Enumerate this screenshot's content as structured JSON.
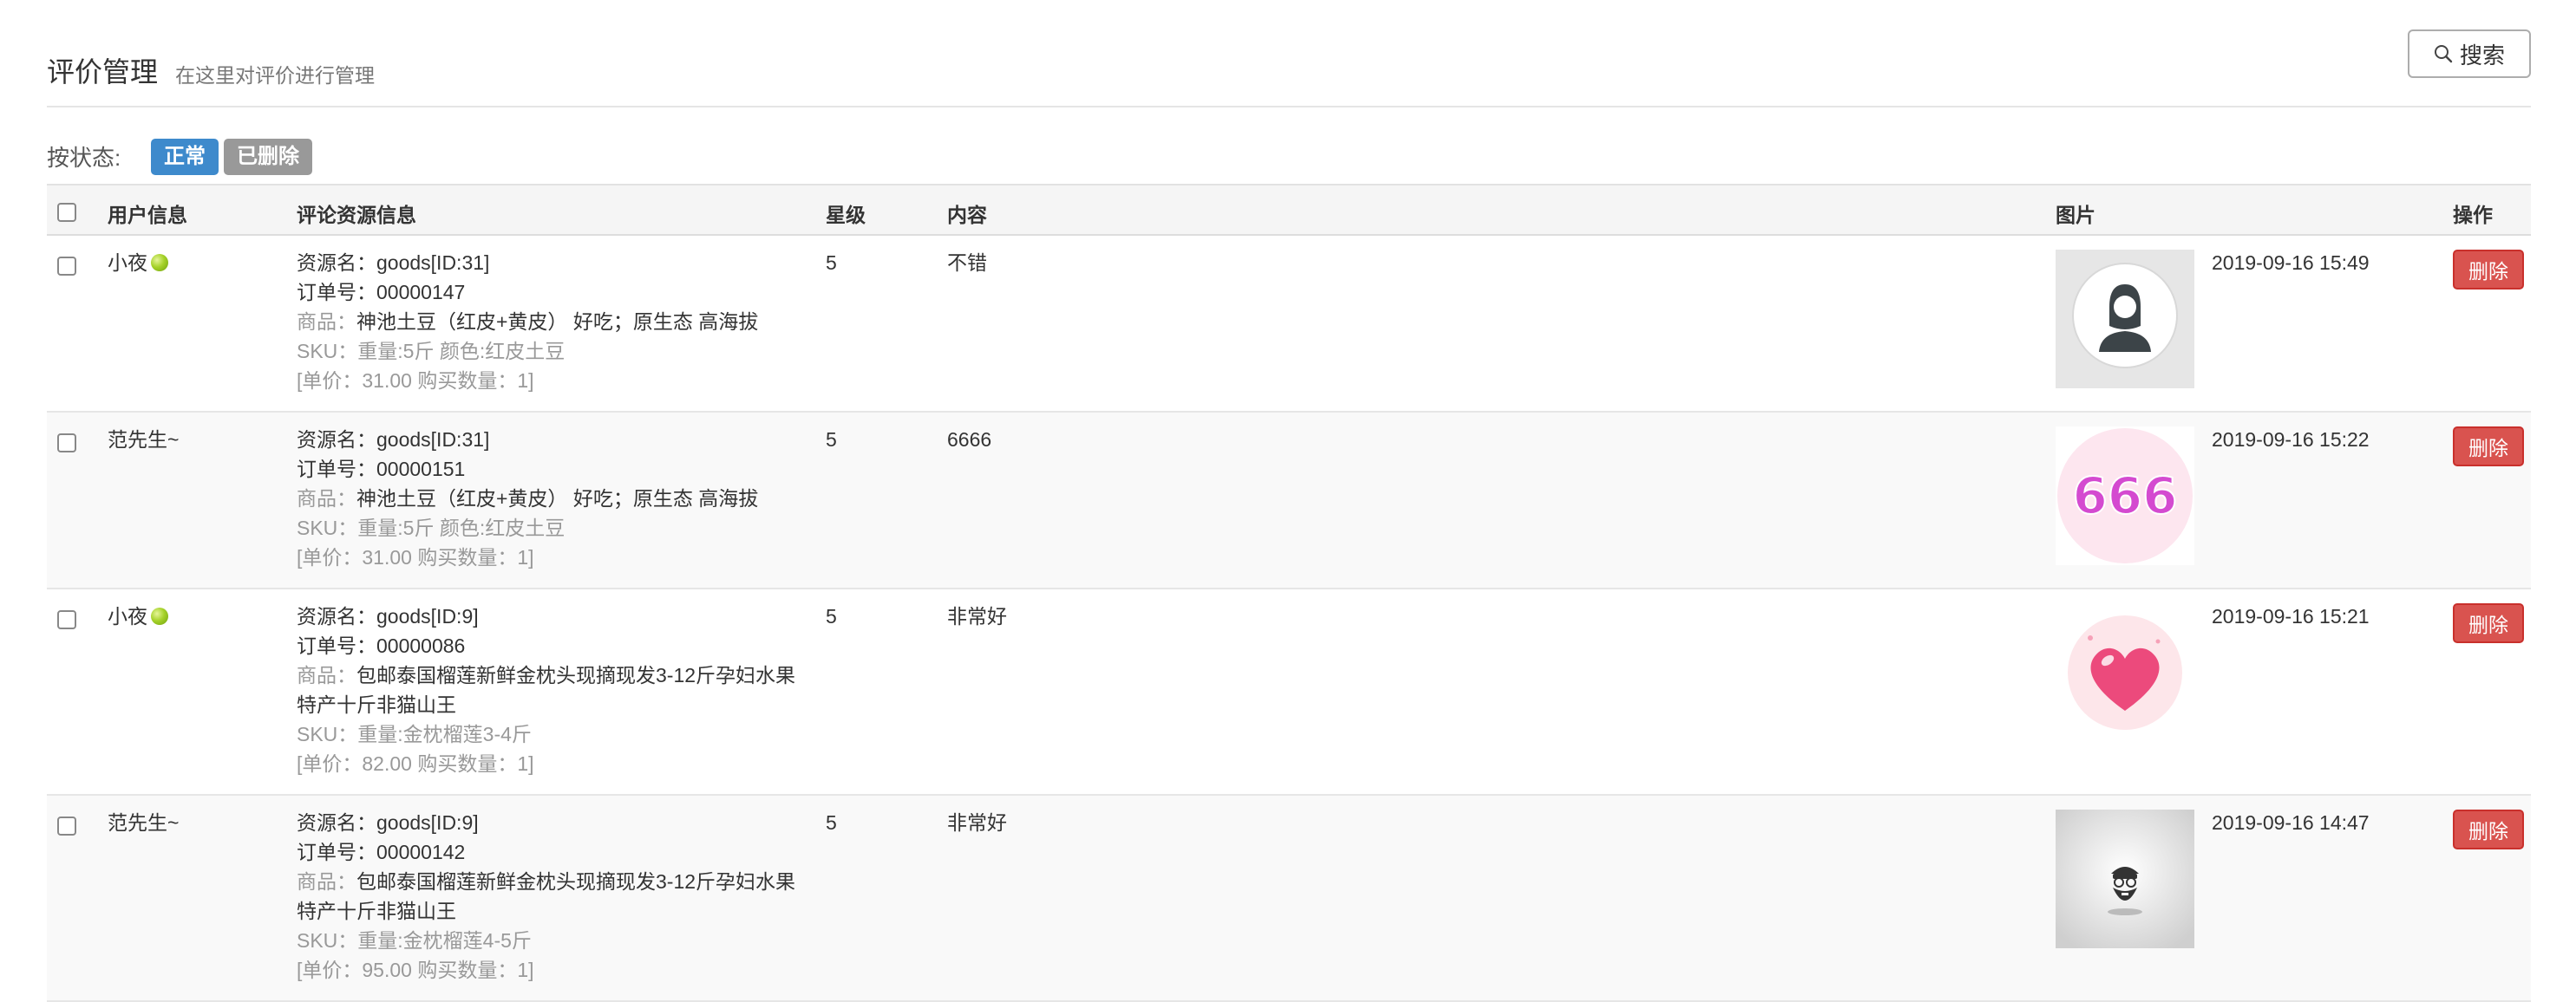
{
  "header": {
    "title": "评价管理",
    "subtitle": "在这里对评价进行管理",
    "search_label": "搜索",
    "search_icon": "search-icon"
  },
  "filter": {
    "label": "按状态:",
    "badges": [
      {
        "label": "正常",
        "color": "#3e8acc"
      },
      {
        "label": "已删除",
        "color": "#999999"
      }
    ]
  },
  "table": {
    "headers": {
      "user": "用户信息",
      "resource": "评论资源信息",
      "star": "星级",
      "content": "内容",
      "image": "图片",
      "action": "操作"
    },
    "rows": [
      {
        "user": "小夜",
        "resource_name": "资源名：goods[ID:31]",
        "order_no": "订单号：00000147",
        "goods_prefix": "商品：",
        "goods_name": "神池土豆（红皮+黄皮） 好吃；原生态 高海拔",
        "sku": "SKU：重量:5斤 颜色:红皮土豆",
        "price": "[单价：31.00 购买数量：1]",
        "star": "5",
        "content": "不错",
        "image_icon": "avatar-person-icon",
        "time": "2019-09-16 15:49",
        "action": "删除"
      },
      {
        "user": "范先生~",
        "resource_name": "资源名：goods[ID:31]",
        "order_no": "订单号：00000151",
        "goods_prefix": "商品：",
        "goods_name": "神池土豆（红皮+黄皮） 好吃；原生态 高海拔",
        "sku": "SKU：重量:5斤 颜色:红皮土豆",
        "price": "[单价：31.00 购买数量：1]",
        "star": "5",
        "content": "6666",
        "image_icon": "666-sticker-icon",
        "image_text": "666",
        "time": "2019-09-16 15:22",
        "action": "删除"
      },
      {
        "user": "小夜",
        "resource_name": "资源名：goods[ID:9]",
        "order_no": "订单号：00000086",
        "goods_prefix": "商品：",
        "goods_name": "包邮泰国榴莲新鲜金枕头现摘现发3-12斤孕妇水果特产十斤非猫山王",
        "sku": "SKU：重量:金枕榴莲3-4斤",
        "price": "[单价：82.00 购买数量：1]",
        "star": "5",
        "content": "非常好",
        "image_icon": "heart-icon",
        "time": "2019-09-16 15:21",
        "action": "删除"
      },
      {
        "user": "范先生~",
        "resource_name": "资源名：goods[ID:9]",
        "order_no": "订单号：00000142",
        "goods_prefix": "商品：",
        "goods_name": "包邮泰国榴莲新鲜金枕头现摘现发3-12斤孕妇水果特产十斤非猫山王",
        "sku": "SKU：重量:金枕榴莲4-5斤",
        "price": "[单价：95.00 购买数量：1]",
        "star": "5",
        "content": "非常好",
        "image_icon": "bearded-avatar-icon",
        "time": "2019-09-16 14:47",
        "action": "删除"
      }
    ]
  },
  "colors": {
    "primary": "#3e8acc",
    "danger": "#d9534f",
    "muted": "#999999"
  }
}
